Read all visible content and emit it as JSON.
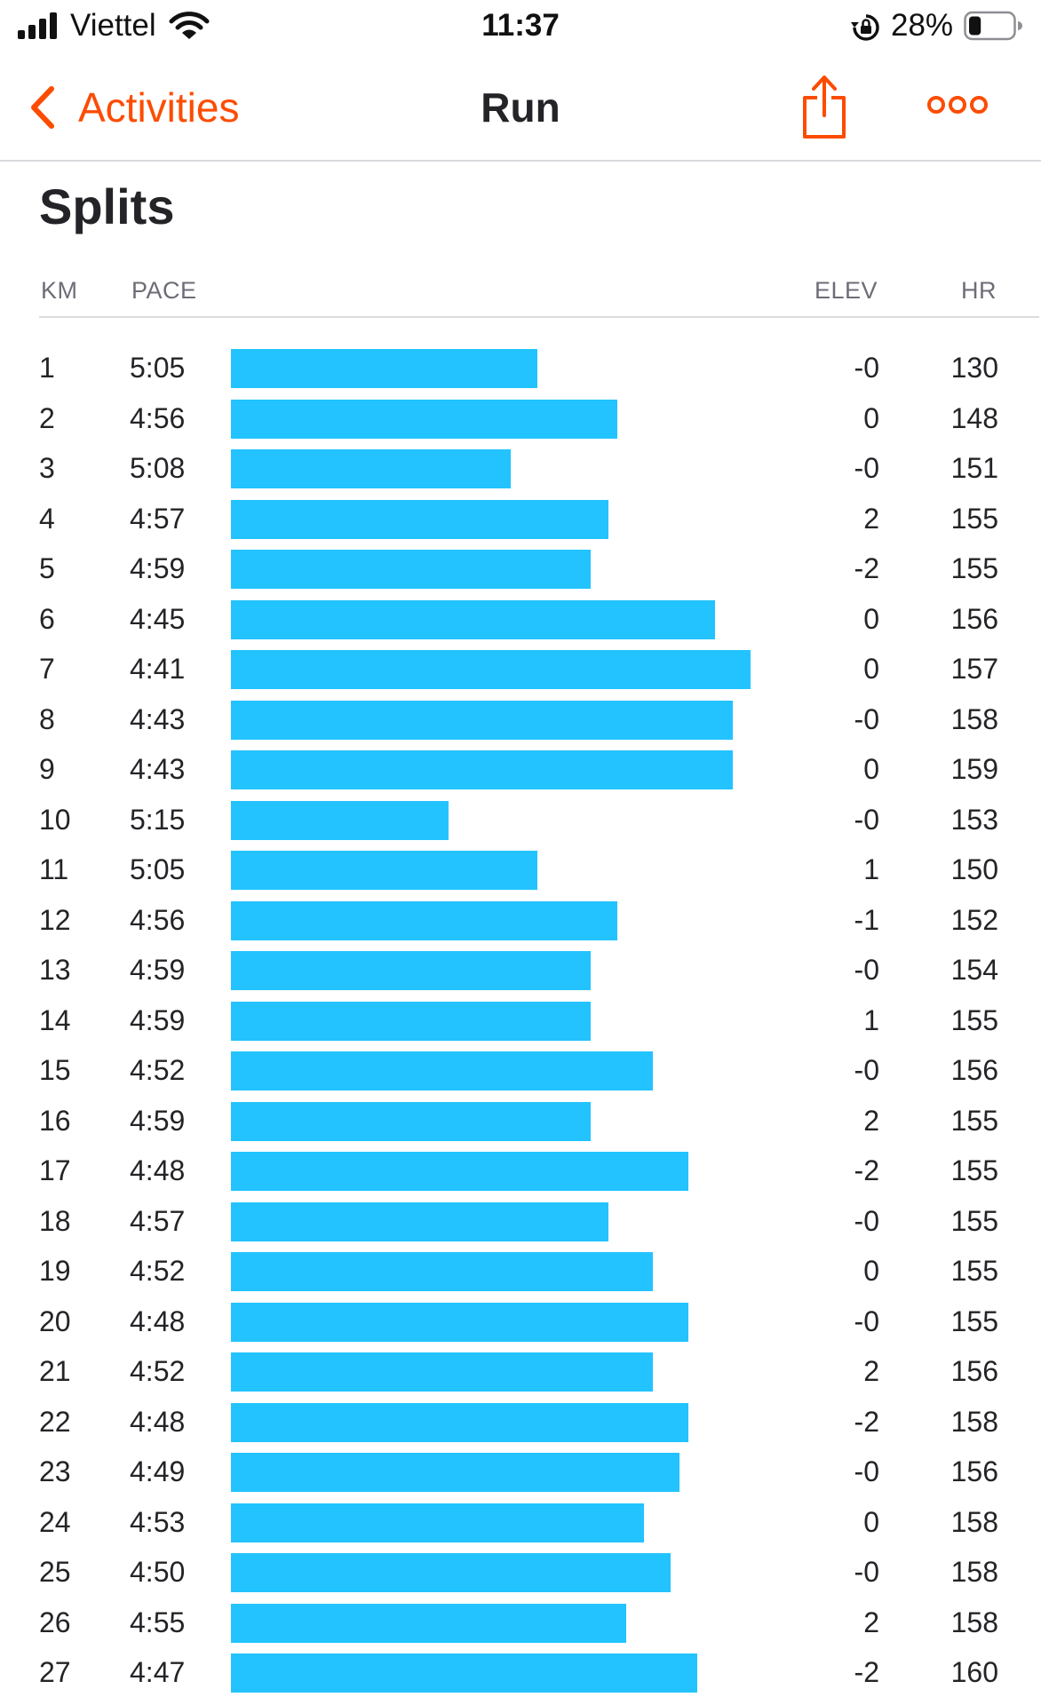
{
  "status_bar": {
    "carrier": "Viettel",
    "time": "11:37",
    "battery_percent": "28%",
    "battery_level": 0.28,
    "icons": [
      "signal-icon",
      "wifi-icon",
      "rotation-lock-icon",
      "battery-icon"
    ]
  },
  "nav": {
    "back_label": "Activities",
    "title": "Run",
    "accent_color": "#fc4c02",
    "icons": [
      "chevron-left-icon",
      "share-icon",
      "more-icon"
    ]
  },
  "splits": {
    "title": "Splits",
    "bar_color": "#23c3ff",
    "columns": {
      "km": "KM",
      "pace": "PACE",
      "elev": "ELEV",
      "hr": "HR"
    },
    "rows": [
      {
        "km": "1",
        "pace": "5:05",
        "elev": "-0",
        "hr": "130"
      },
      {
        "km": "2",
        "pace": "4:56",
        "elev": "0",
        "hr": "148"
      },
      {
        "km": "3",
        "pace": "5:08",
        "elev": "-0",
        "hr": "151"
      },
      {
        "km": "4",
        "pace": "4:57",
        "elev": "2",
        "hr": "155"
      },
      {
        "km": "5",
        "pace": "4:59",
        "elev": "-2",
        "hr": "155"
      },
      {
        "km": "6",
        "pace": "4:45",
        "elev": "0",
        "hr": "156"
      },
      {
        "km": "7",
        "pace": "4:41",
        "elev": "0",
        "hr": "157"
      },
      {
        "km": "8",
        "pace": "4:43",
        "elev": "-0",
        "hr": "158"
      },
      {
        "km": "9",
        "pace": "4:43",
        "elev": "0",
        "hr": "159"
      },
      {
        "km": "10",
        "pace": "5:15",
        "elev": "-0",
        "hr": "153"
      },
      {
        "km": "11",
        "pace": "5:05",
        "elev": "1",
        "hr": "150"
      },
      {
        "km": "12",
        "pace": "4:56",
        "elev": "-1",
        "hr": "152"
      },
      {
        "km": "13",
        "pace": "4:59",
        "elev": "-0",
        "hr": "154"
      },
      {
        "km": "14",
        "pace": "4:59",
        "elev": "1",
        "hr": "155"
      },
      {
        "km": "15",
        "pace": "4:52",
        "elev": "-0",
        "hr": "156"
      },
      {
        "km": "16",
        "pace": "4:59",
        "elev": "2",
        "hr": "155"
      },
      {
        "km": "17",
        "pace": "4:48",
        "elev": "-2",
        "hr": "155"
      },
      {
        "km": "18",
        "pace": "4:57",
        "elev": "-0",
        "hr": "155"
      },
      {
        "km": "19",
        "pace": "4:52",
        "elev": "0",
        "hr": "155"
      },
      {
        "km": "20",
        "pace": "4:48",
        "elev": "-0",
        "hr": "155"
      },
      {
        "km": "21",
        "pace": "4:52",
        "elev": "2",
        "hr": "156"
      },
      {
        "km": "22",
        "pace": "4:48",
        "elev": "-2",
        "hr": "158"
      },
      {
        "km": "23",
        "pace": "4:49",
        "elev": "-0",
        "hr": "156"
      },
      {
        "km": "24",
        "pace": "4:53",
        "elev": "0",
        "hr": "158"
      },
      {
        "km": "25",
        "pace": "4:50",
        "elev": "-0",
        "hr": "158"
      },
      {
        "km": "26",
        "pace": "4:55",
        "elev": "2",
        "hr": "158"
      },
      {
        "km": "27",
        "pace": "4:47",
        "elev": "-2",
        "hr": "160"
      }
    ]
  }
}
